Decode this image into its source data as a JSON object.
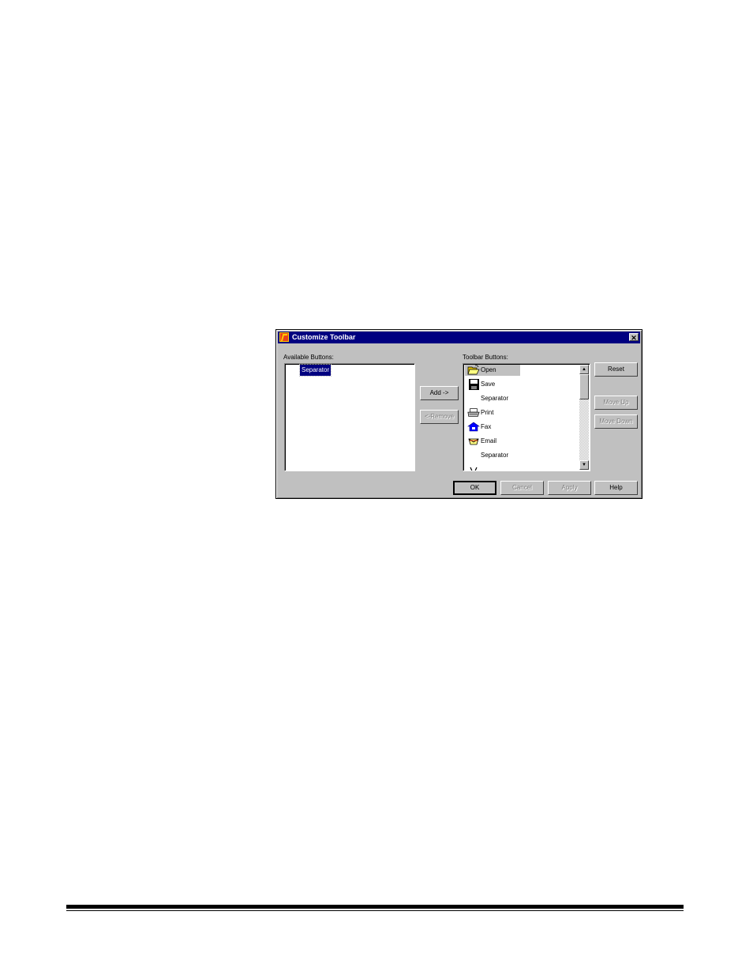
{
  "dialog": {
    "title": "Customize Toolbar",
    "close_glyph": "✕"
  },
  "available": {
    "label": "Available Buttons:",
    "items": [
      "Separator"
    ]
  },
  "toolbar": {
    "label": "Toolbar Buttons:",
    "items": [
      {
        "label": "Open",
        "icon": "folder-open-icon"
      },
      {
        "label": "Save",
        "icon": "floppy-disk-icon"
      },
      {
        "label": "Separator",
        "icon": ""
      },
      {
        "label": "Print",
        "icon": "printer-icon"
      },
      {
        "label": "Fax",
        "icon": "fax-icon"
      },
      {
        "label": "Email",
        "icon": "envelope-icon"
      },
      {
        "label": "Separator",
        "icon": ""
      }
    ]
  },
  "buttons": {
    "add": "Add ->",
    "remove": "<-Remove",
    "reset": "Reset",
    "move_up": "Move Up",
    "move_down": "Move Down",
    "ok": "OK",
    "cancel": "Cancel",
    "apply": "Apply",
    "help": "Help"
  }
}
